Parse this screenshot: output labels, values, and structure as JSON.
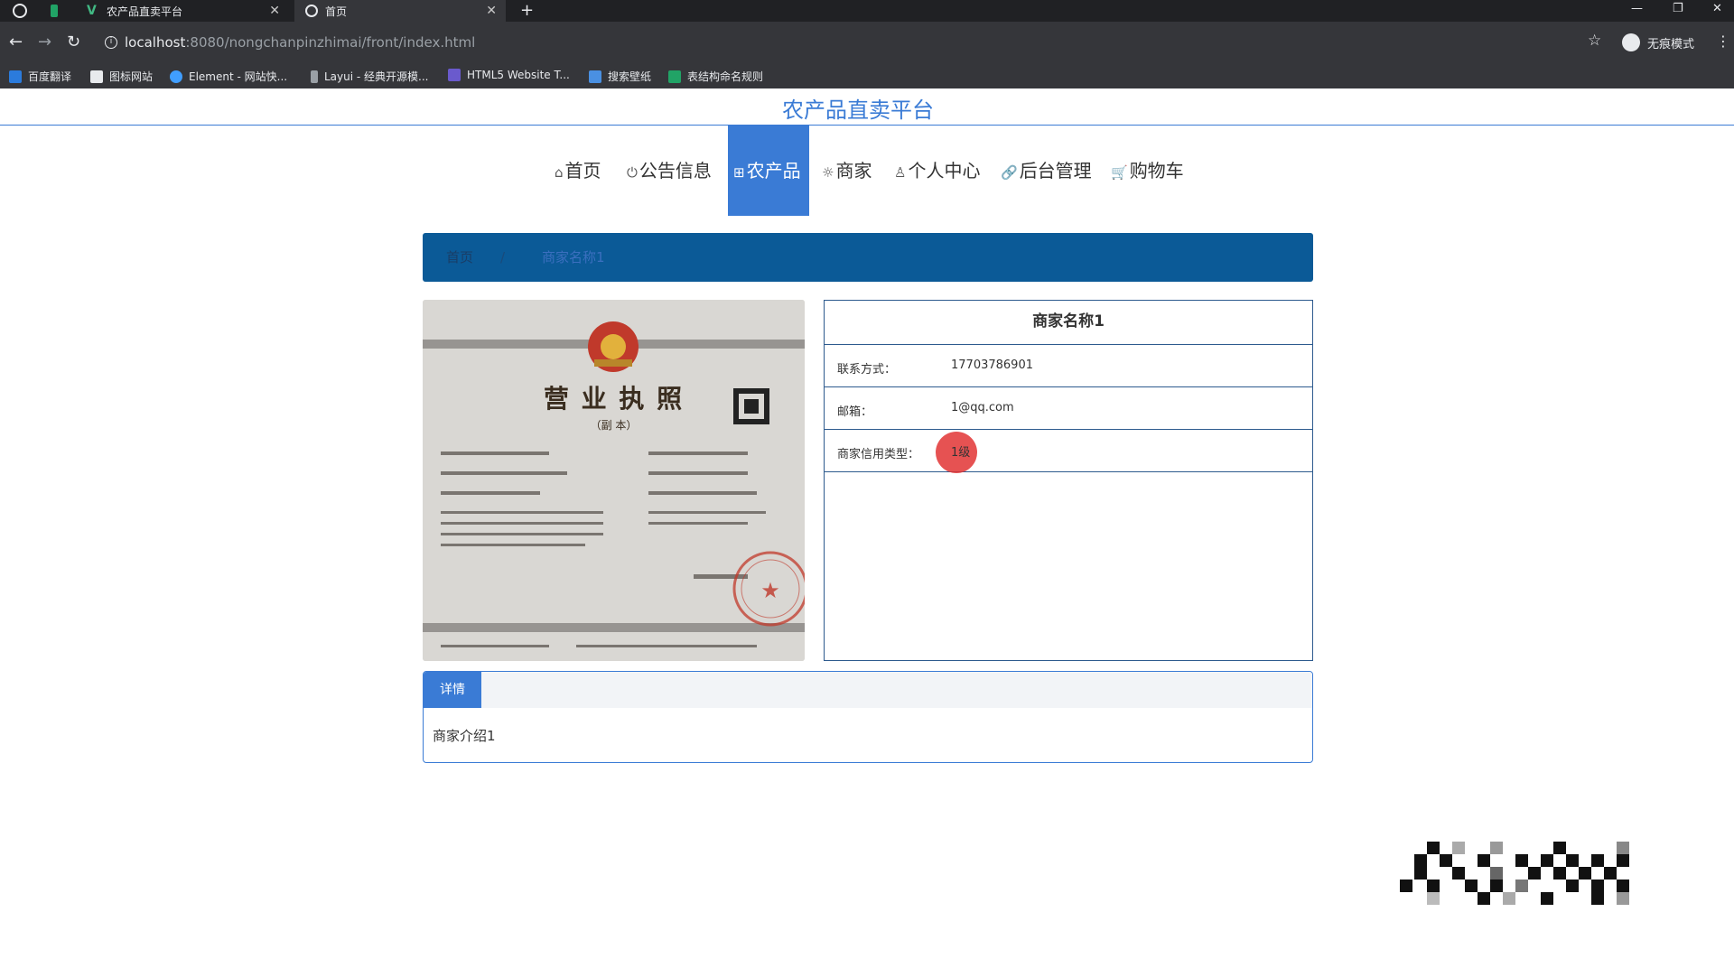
{
  "browser": {
    "tabs": [
      {
        "label": "农产品直卖平台",
        "active": false
      },
      {
        "label": "首页",
        "active": true
      }
    ],
    "url_host": "localhost",
    "url_path": ":8080/nongchanpinzhimai/front/index.html",
    "incognito_label": "无痕模式",
    "bookmarks": [
      {
        "label": "百度翻译",
        "color": "#2b7bdc"
      },
      {
        "label": "图标网站",
        "color": "#e8eaed"
      },
      {
        "label": "Element - 网站快...",
        "color": "#409eff"
      },
      {
        "label": "Layui - 经典开源模...",
        "color": "#9aa0a6"
      },
      {
        "label": "HTML5 Website T...",
        "color": "#6a5acd"
      },
      {
        "label": "搜索壁纸",
        "color": "#4a90e2"
      },
      {
        "label": "表结构命名规则",
        "color": "#21a366"
      }
    ]
  },
  "site": {
    "title": "农产品直卖平台",
    "accent": "#3a7bd5",
    "nav": [
      {
        "label": "首页",
        "icon": "home-icon",
        "glyph": "⌂",
        "active": false
      },
      {
        "label": "公告信息",
        "icon": "power-icon",
        "glyph": "⏻",
        "active": false
      },
      {
        "label": "农产品",
        "icon": "grid-icon",
        "glyph": "⊞",
        "active": true
      },
      {
        "label": "商家",
        "icon": "gear-icon",
        "glyph": "☼",
        "active": false
      },
      {
        "label": "个人中心",
        "icon": "user-icon",
        "glyph": "♙",
        "active": false
      },
      {
        "label": "后台管理",
        "icon": "link-icon",
        "glyph": "🔗",
        "active": false
      },
      {
        "label": "购物车",
        "icon": "cart-icon",
        "glyph": "🛒",
        "active": false
      }
    ]
  },
  "breadcrumb": {
    "home": "首页",
    "separator": "/",
    "current": "商家名称1"
  },
  "licence": {
    "header": "营 业 执 照",
    "subheader": "（副 本）"
  },
  "merchant": {
    "name": "商家名称1",
    "rows": [
      {
        "label": "联系方式：",
        "value": "17703786901"
      },
      {
        "label": "邮箱：",
        "value": "1@qq.com"
      },
      {
        "label": "商家信用类型：",
        "value": "1级"
      }
    ]
  },
  "detail": {
    "tab": "详情",
    "body": "商家介绍1"
  }
}
